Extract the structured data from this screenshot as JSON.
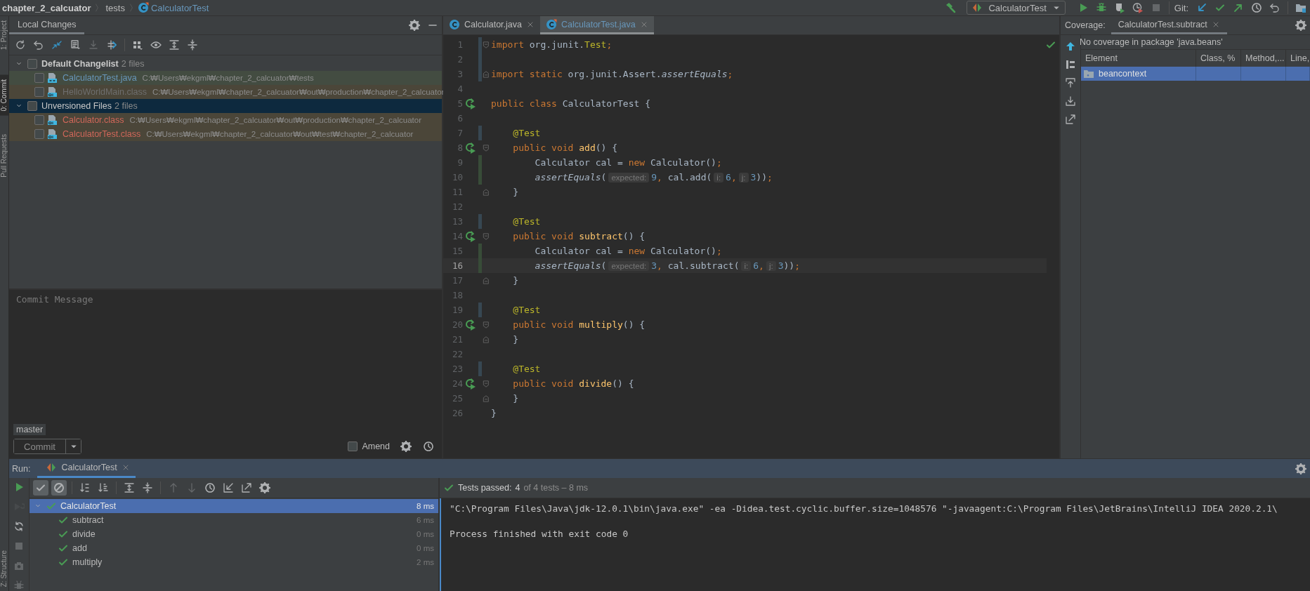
{
  "breadcrumbs": [
    {
      "label": "chapter_2_calcuator",
      "kind": "project"
    },
    {
      "label": "tests",
      "kind": "folder"
    },
    {
      "label": "CalculatorTest",
      "kind": "class"
    }
  ],
  "toolbar": {
    "run_config": "CalculatorTest",
    "actions": [
      {
        "disabled": false
      },
      {
        "disabled": false
      },
      {
        "disabled": false
      },
      {
        "disabled": false
      },
      {
        "disabled": true
      }
    ],
    "git_label": "Git:",
    "git_actions": [
      {
        "disabled": false
      },
      {
        "disabled": false
      },
      {
        "disabled": false
      },
      {
        "disabled": false
      },
      {
        "disabled": false
      }
    ]
  },
  "tool_tabs": [
    {
      "label": "1: Project",
      "selected": false
    },
    {
      "label": "0: Commit",
      "selected": true
    },
    {
      "label": "Pull Requests",
      "selected": false
    },
    {
      "label": "Z: Structure",
      "selected": false
    }
  ],
  "changes": {
    "tab": {
      "label": "Local Changes",
      "selected": true
    },
    "toolbar": [
      {
        "disabled": false
      },
      {
        "disabled": false
      },
      {
        "disabled": false
      },
      {
        "disabled": false
      },
      {
        "disabled": true
      },
      {
        "disabled": false
      },
      {
        "disabled": false
      },
      {
        "disabled": false
      },
      {
        "disabled": false
      },
      {
        "disabled": false
      }
    ],
    "changelists": [
      {
        "name": "Default Changelist",
        "count": "2 files",
        "expanded": true,
        "checked": false,
        "selected": false,
        "files": [
          {
            "name": "CalculatorTest.java",
            "path": "C:₩Users₩ekgml₩chapter_2_calcuator₩tests",
            "kind": "modified",
            "checked": false,
            "selected": false
          },
          {
            "name": "HelloWorldMain.class",
            "path": "C:₩Users₩ekgml₩chapter_2_calcuator₩out₩production₩chapter_2_calcuator",
            "kind": "ignored",
            "checked": false,
            "selected": false
          }
        ]
      },
      {
        "name": "Unversioned Files",
        "count": "2 files",
        "expanded": true,
        "checked": false,
        "selected": true,
        "files": [
          {
            "name": "Calculator.class",
            "path": "C:₩Users₩ekgml₩chapter_2_calcuator₩out₩production₩chapter_2_calcuator",
            "kind": "unversioned",
            "checked": false,
            "selected": false
          },
          {
            "name": "CalculatorTest.class",
            "path": "C:₩Users₩ekgml₩chapter_2_calcuator₩out₩test₩chapter_2_calcuator",
            "kind": "unversioned",
            "checked": false,
            "selected": false
          }
        ]
      }
    ],
    "commit": {
      "placeholder": "Commit Message",
      "branch": "master",
      "button": "Commit",
      "amend": {
        "label": "Amend",
        "checked": false
      }
    }
  },
  "editor": {
    "tabs": [
      {
        "label": "Calculator.java",
        "modified": false,
        "selected": false
      },
      {
        "label": "CalculatorTest.java",
        "modified": true,
        "selected": true
      }
    ],
    "lines": [
      {
        "number": "1",
        "kind": "modified",
        "runnable": false,
        "current": false,
        "fold_start": true,
        "fold_end": false,
        "tokens": [
          {
            "t": "import",
            "kind": "kw"
          },
          {
            "t": " org.junit.",
            "kind": "id"
          },
          {
            "t": "Test",
            "kind": "ann"
          },
          {
            "t": ";",
            "kind": "kw"
          }
        ]
      },
      {
        "number": "2",
        "kind": "modified",
        "runnable": false,
        "current": false,
        "fold_start": false,
        "fold_end": false
      },
      {
        "number": "3",
        "kind": "modified",
        "runnable": false,
        "current": false,
        "fold_start": false,
        "fold_end": true,
        "tokens": [
          {
            "t": "import static",
            "kind": "kw"
          },
          {
            "t": " org.junit.Assert.",
            "kind": "id"
          },
          {
            "t": "assertEquals",
            "kind": "it"
          },
          {
            "t": ";",
            "kind": "kw"
          }
        ]
      },
      {
        "number": "4",
        "kind": "plain",
        "runnable": false,
        "current": false,
        "fold_start": false,
        "fold_end": false
      },
      {
        "number": "5",
        "kind": "plain",
        "runnable": true,
        "current": false,
        "fold_start": false,
        "fold_end": false,
        "tokens": [
          {
            "t": "public class",
            "kind": "kw"
          },
          {
            "t": " CalculatorTest {",
            "kind": "id"
          }
        ]
      },
      {
        "number": "6",
        "kind": "plain",
        "runnable": false,
        "current": false,
        "fold_start": false,
        "fold_end": false
      },
      {
        "number": "7",
        "kind": "modified",
        "runnable": false,
        "current": false,
        "fold_start": false,
        "fold_end": false,
        "tokens": [
          {
            "t": "    @Test",
            "kind": "ann"
          }
        ]
      },
      {
        "number": "8",
        "kind": "plain",
        "runnable": true,
        "current": false,
        "fold_start": true,
        "fold_end": false,
        "tokens": [
          {
            "t": "    public void",
            "kind": "kw"
          },
          {
            "t": " add",
            "kind": "fn"
          },
          {
            "t": "() {",
            "kind": "id"
          }
        ]
      },
      {
        "number": "9",
        "kind": "added",
        "runnable": false,
        "current": false,
        "fold_start": false,
        "fold_end": false,
        "tokens": [
          {
            "t": "        Calculator cal = ",
            "kind": "id"
          },
          {
            "t": "new",
            "kind": "kw"
          },
          {
            "t": " Calculator()",
            "kind": "id"
          },
          {
            "t": ";",
            "kind": "kw"
          }
        ]
      },
      {
        "number": "10",
        "kind": "added",
        "runnable": false,
        "current": false,
        "fold_start": false,
        "fold_end": false,
        "tokens": [
          {
            "t": "        assertEquals",
            "kind": "it"
          },
          {
            "t": "(",
            "kind": "id"
          },
          {
            "t": "expected:",
            "kind": "hint"
          },
          {
            "t": "9",
            "kind": "num"
          },
          {
            "t": ",",
            "kind": "kw"
          },
          {
            "t": " cal.add(",
            "kind": "id"
          },
          {
            "t": "i:",
            "kind": "hint"
          },
          {
            "t": "6",
            "kind": "num"
          },
          {
            "t": ",",
            "kind": "kw"
          },
          {
            "t": "j:",
            "kind": "hint"
          },
          {
            "t": "3",
            "kind": "num"
          },
          {
            "t": "))",
            "kind": "id"
          },
          {
            "t": ";",
            "kind": "kw"
          }
        ]
      },
      {
        "number": "11",
        "kind": "plain",
        "runnable": false,
        "current": false,
        "fold_start": false,
        "fold_end": true,
        "tokens": [
          {
            "t": "    }",
            "kind": "id"
          }
        ]
      },
      {
        "number": "12",
        "kind": "plain",
        "runnable": false,
        "current": false,
        "fold_start": false,
        "fold_end": false
      },
      {
        "number": "13",
        "kind": "modified",
        "runnable": false,
        "current": false,
        "fold_start": false,
        "fold_end": false,
        "tokens": [
          {
            "t": "    @Test",
            "kind": "ann"
          }
        ]
      },
      {
        "number": "14",
        "kind": "plain",
        "runnable": true,
        "current": false,
        "fold_start": true,
        "fold_end": false,
        "tokens": [
          {
            "t": "    public void",
            "kind": "kw"
          },
          {
            "t": " subtract",
            "kind": "fn"
          },
          {
            "t": "() {",
            "kind": "id"
          }
        ]
      },
      {
        "number": "15",
        "kind": "added",
        "runnable": false,
        "current": false,
        "fold_start": false,
        "fold_end": false,
        "tokens": [
          {
            "t": "        Calculator cal = ",
            "kind": "id"
          },
          {
            "t": "new",
            "kind": "kw"
          },
          {
            "t": " Calculator()",
            "kind": "id"
          },
          {
            "t": ";",
            "kind": "kw"
          }
        ]
      },
      {
        "number": "16",
        "kind": "added",
        "runnable": false,
        "current": true,
        "fold_start": false,
        "fold_end": false,
        "tokens": [
          {
            "t": "        assertEquals",
            "kind": "it"
          },
          {
            "t": "(",
            "kind": "id"
          },
          {
            "t": "expected:",
            "kind": "hint"
          },
          {
            "t": "3",
            "kind": "num"
          },
          {
            "t": ",",
            "kind": "kw"
          },
          {
            "t": " cal.subtract(",
            "kind": "id"
          },
          {
            "t": "i:",
            "kind": "hint"
          },
          {
            "t": "6",
            "kind": "num"
          },
          {
            "t": ",",
            "kind": "kw"
          },
          {
            "t": "j:",
            "kind": "hint"
          },
          {
            "t": "3",
            "kind": "num"
          },
          {
            "t": "))",
            "kind": "id"
          },
          {
            "t": ";",
            "kind": "kw"
          }
        ]
      },
      {
        "number": "17",
        "kind": "plain",
        "runnable": false,
        "current": false,
        "fold_start": false,
        "fold_end": true,
        "tokens": [
          {
            "t": "    }",
            "kind": "id"
          }
        ]
      },
      {
        "number": "18",
        "kind": "plain",
        "runnable": false,
        "current": false,
        "fold_start": false,
        "fold_end": false
      },
      {
        "number": "19",
        "kind": "modified",
        "runnable": false,
        "current": false,
        "fold_start": false,
        "fold_end": false,
        "tokens": [
          {
            "t": "    @Test",
            "kind": "ann"
          }
        ]
      },
      {
        "number": "20",
        "kind": "plain",
        "runnable": true,
        "current": false,
        "fold_start": true,
        "fold_end": false,
        "tokens": [
          {
            "t": "    public void",
            "kind": "kw"
          },
          {
            "t": " multiply",
            "kind": "fn"
          },
          {
            "t": "() {",
            "kind": "id"
          }
        ]
      },
      {
        "number": "21",
        "kind": "plain",
        "runnable": false,
        "current": false,
        "fold_start": false,
        "fold_end": true,
        "tokens": [
          {
            "t": "    }",
            "kind": "id"
          }
        ]
      },
      {
        "number": "22",
        "kind": "plain",
        "runnable": false,
        "current": false,
        "fold_start": false,
        "fold_end": false
      },
      {
        "number": "23",
        "kind": "modified",
        "runnable": false,
        "current": false,
        "fold_start": false,
        "fold_end": false,
        "tokens": [
          {
            "t": "    @Test",
            "kind": "ann"
          }
        ]
      },
      {
        "number": "24",
        "kind": "plain",
        "runnable": true,
        "current": false,
        "fold_start": true,
        "fold_end": false,
        "tokens": [
          {
            "t": "    public void",
            "kind": "kw"
          },
          {
            "t": " divide",
            "kind": "fn"
          },
          {
            "t": "() {",
            "kind": "id"
          }
        ]
      },
      {
        "number": "25",
        "kind": "plain",
        "runnable": false,
        "current": false,
        "fold_start": false,
        "fold_end": true,
        "tokens": [
          {
            "t": "    }",
            "kind": "id"
          }
        ]
      },
      {
        "number": "26",
        "kind": "plain",
        "runnable": false,
        "current": false,
        "fold_start": false,
        "fold_end": false,
        "tokens": [
          {
            "t": "}",
            "kind": "id"
          }
        ]
      }
    ]
  },
  "coverage": {
    "label": "Coverage:",
    "tab": {
      "label": "CalculatorTest.subtract",
      "selected": true
    },
    "message": "No coverage in package 'java.beans'",
    "columns": [
      "Element",
      "Class, %",
      "Method,...",
      "Line,"
    ],
    "rows": [
      {
        "element": "beancontext",
        "selected": true
      }
    ]
  },
  "run": {
    "label": "Run:",
    "tab": {
      "label": "CalculatorTest",
      "selected": true
    },
    "side_actions": [
      {
        "disabled": false
      },
      {
        "disabled": true
      },
      {
        "disabled": false
      },
      {
        "disabled": true
      },
      {
        "disabled": true
      },
      {
        "disabled": true
      }
    ],
    "toolbar": [
      {
        "selected": true,
        "disabled": false
      },
      {
        "selected": true,
        "disabled": false
      },
      {
        "selected": false,
        "disabled": false
      },
      {
        "selected": false,
        "disabled": false
      },
      {
        "selected": false,
        "disabled": false
      },
      {
        "selected": false,
        "disabled": false
      },
      {
        "selected": false,
        "disabled": true
      },
      {
        "selected": false,
        "disabled": true
      },
      {
        "selected": false,
        "disabled": false
      },
      {
        "selected": false,
        "disabled": false
      },
      {
        "selected": false,
        "disabled": false
      },
      {
        "selected": false,
        "disabled": false
      }
    ],
    "tests": [
      {
        "name": "CalculatorTest",
        "time": "8 ms",
        "passed": true,
        "expanded": true,
        "selected": true,
        "children": [
          {
            "name": "subtract",
            "time": "6 ms",
            "passed": true,
            "selected": false
          },
          {
            "name": "divide",
            "time": "0 ms",
            "passed": true,
            "selected": false
          },
          {
            "name": "add",
            "time": "0 ms",
            "passed": true,
            "selected": false
          },
          {
            "name": "multiply",
            "time": "2 ms",
            "passed": true,
            "selected": false
          }
        ]
      }
    ],
    "status": {
      "passed": true,
      "label": "Tests passed:",
      "count": "4",
      "detail": "of 4 tests – 8 ms"
    },
    "console": [
      {
        "kind": "command",
        "text": "\"C:\\Program Files\\Java\\jdk-12.0.1\\bin\\java.exe\" -ea -Didea.test.cyclic.buffer.size=1048576 \"-javaagent:C:\\Program Files\\JetBrains\\IntelliJ IDEA 2020.2.1\\"
      },
      {
        "kind": "exit",
        "text": "Process finished with exit code 0"
      }
    ]
  }
}
